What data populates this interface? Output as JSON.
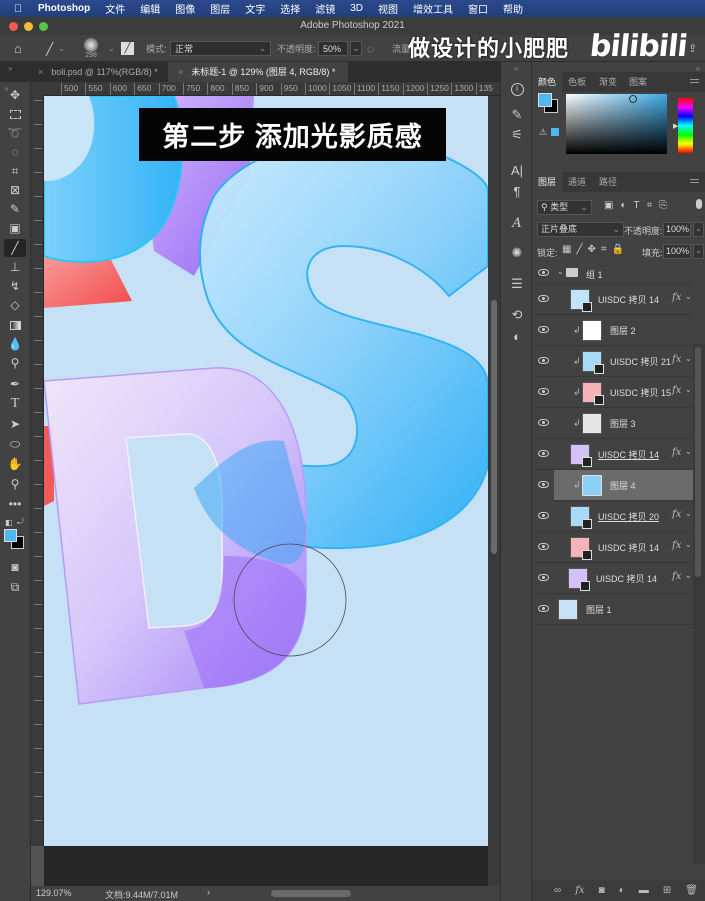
{
  "menubar": {
    "apple_icon": "apple-icon",
    "items": [
      "Photoshop",
      "文件",
      "编辑",
      "图像",
      "图层",
      "文字",
      "选择",
      "滤镜",
      "3D",
      "视图",
      "增效工具",
      "窗口",
      "帮助"
    ]
  },
  "window": {
    "title": "Adobe Photoshop 2021"
  },
  "options": {
    "home_icon": "home-icon",
    "brush_size": "298",
    "mode_label": "模式:",
    "mode_value": "正常",
    "opacity_label": "不透明度:",
    "opacity_value": "50%",
    "flow_label": "流量:",
    "watermark": "做设计的小肥肥",
    "brand": "bilibili"
  },
  "tabs": [
    {
      "label": "boli.psd @ 117%(RGB/8) *",
      "active": false
    },
    {
      "label": "未标题-1 @ 129% (图层 4, RGB/8) *",
      "active": true
    }
  ],
  "ruler": {
    "h_ticks": [
      "500",
      "550",
      "600",
      "650",
      "700",
      "750",
      "800",
      "850",
      "900",
      "950",
      "1000",
      "1050",
      "1100",
      "1150",
      "1200",
      "1250",
      "1300",
      "135"
    ]
  },
  "canvas": {
    "caption": "第二步 添加光影质感",
    "colors": {
      "background": "#c6e0f5",
      "blue": "#3bb5f5",
      "purple": "#a57df7",
      "red": "#f25a5a"
    }
  },
  "status": {
    "zoom": "129.07%",
    "doc": "文档:9.44M/7.01M",
    "arrow": "›"
  },
  "color_panel": {
    "tabs": [
      "颜色",
      "色板",
      "渐变",
      "图案"
    ],
    "foreground": "#4fb8f0",
    "background": "#000000",
    "hue_color": "#3aa9e6"
  },
  "layers_panel": {
    "tabs": [
      "图层",
      "通道",
      "路径"
    ],
    "filter_label": "类型",
    "blend_mode": "正片叠底",
    "opacity_label": "不透明度:",
    "opacity_value": "100%",
    "lock_label": "锁定:",
    "fill_label": "填充:",
    "fill_value": "100%",
    "group_name": "组 1",
    "layers": [
      {
        "name": "UISDC 拷贝 14",
        "fx": "fx",
        "clip": false,
        "underline": false,
        "thumb": "#bfe4fb",
        "smart": true,
        "indent": 1
      },
      {
        "name": "图层 2",
        "fx": "",
        "clip": true,
        "underline": false,
        "thumb": "#ffffff",
        "smart": false,
        "indent": 2
      },
      {
        "name": "UISDC 拷贝 21",
        "fx": "fx",
        "clip": true,
        "underline": false,
        "thumb": "#a9dbf8",
        "smart": true,
        "indent": 2
      },
      {
        "name": "UISDC 拷贝 15",
        "fx": "fx",
        "clip": true,
        "underline": false,
        "thumb": "#f6b3b8",
        "smart": true,
        "indent": 2
      },
      {
        "name": "图层 3",
        "fx": "",
        "clip": true,
        "underline": false,
        "thumb": "#e6e6e6",
        "smart": false,
        "indent": 2
      },
      {
        "name": "UISDC 拷贝 14",
        "fx": "fx",
        "clip": false,
        "underline": true,
        "thumb": "#d3c2f7",
        "smart": true,
        "indent": 1
      },
      {
        "name": "图层 4",
        "fx": "",
        "clip": true,
        "underline": false,
        "thumb": "#8ccff7",
        "smart": false,
        "indent": 2,
        "selected": true
      },
      {
        "name": "UISDC 拷贝 20",
        "fx": "fx",
        "clip": false,
        "underline": true,
        "thumb": "#a9dbf8",
        "smart": true,
        "indent": 1
      },
      {
        "name": "UISDC 拷贝 14",
        "fx": "fx",
        "clip": false,
        "underline": false,
        "thumb": "#f6b3b8",
        "smart": true,
        "indent": 1
      },
      {
        "name": "UISDC 拷贝 14",
        "fx": "fx",
        "clip": false,
        "underline": false,
        "thumb": "#d3c2f7",
        "smart": true,
        "indent": 0
      },
      {
        "name": "图层 1",
        "fx": "",
        "clip": false,
        "underline": false,
        "thumb": "#c6e0f5",
        "smart": false,
        "indent": -1
      }
    ],
    "bottom_icons": [
      "link-icon",
      "fx-icon",
      "mask-icon",
      "adjustment-icon",
      "folder-icon",
      "new-layer-icon",
      "trash-icon"
    ]
  }
}
